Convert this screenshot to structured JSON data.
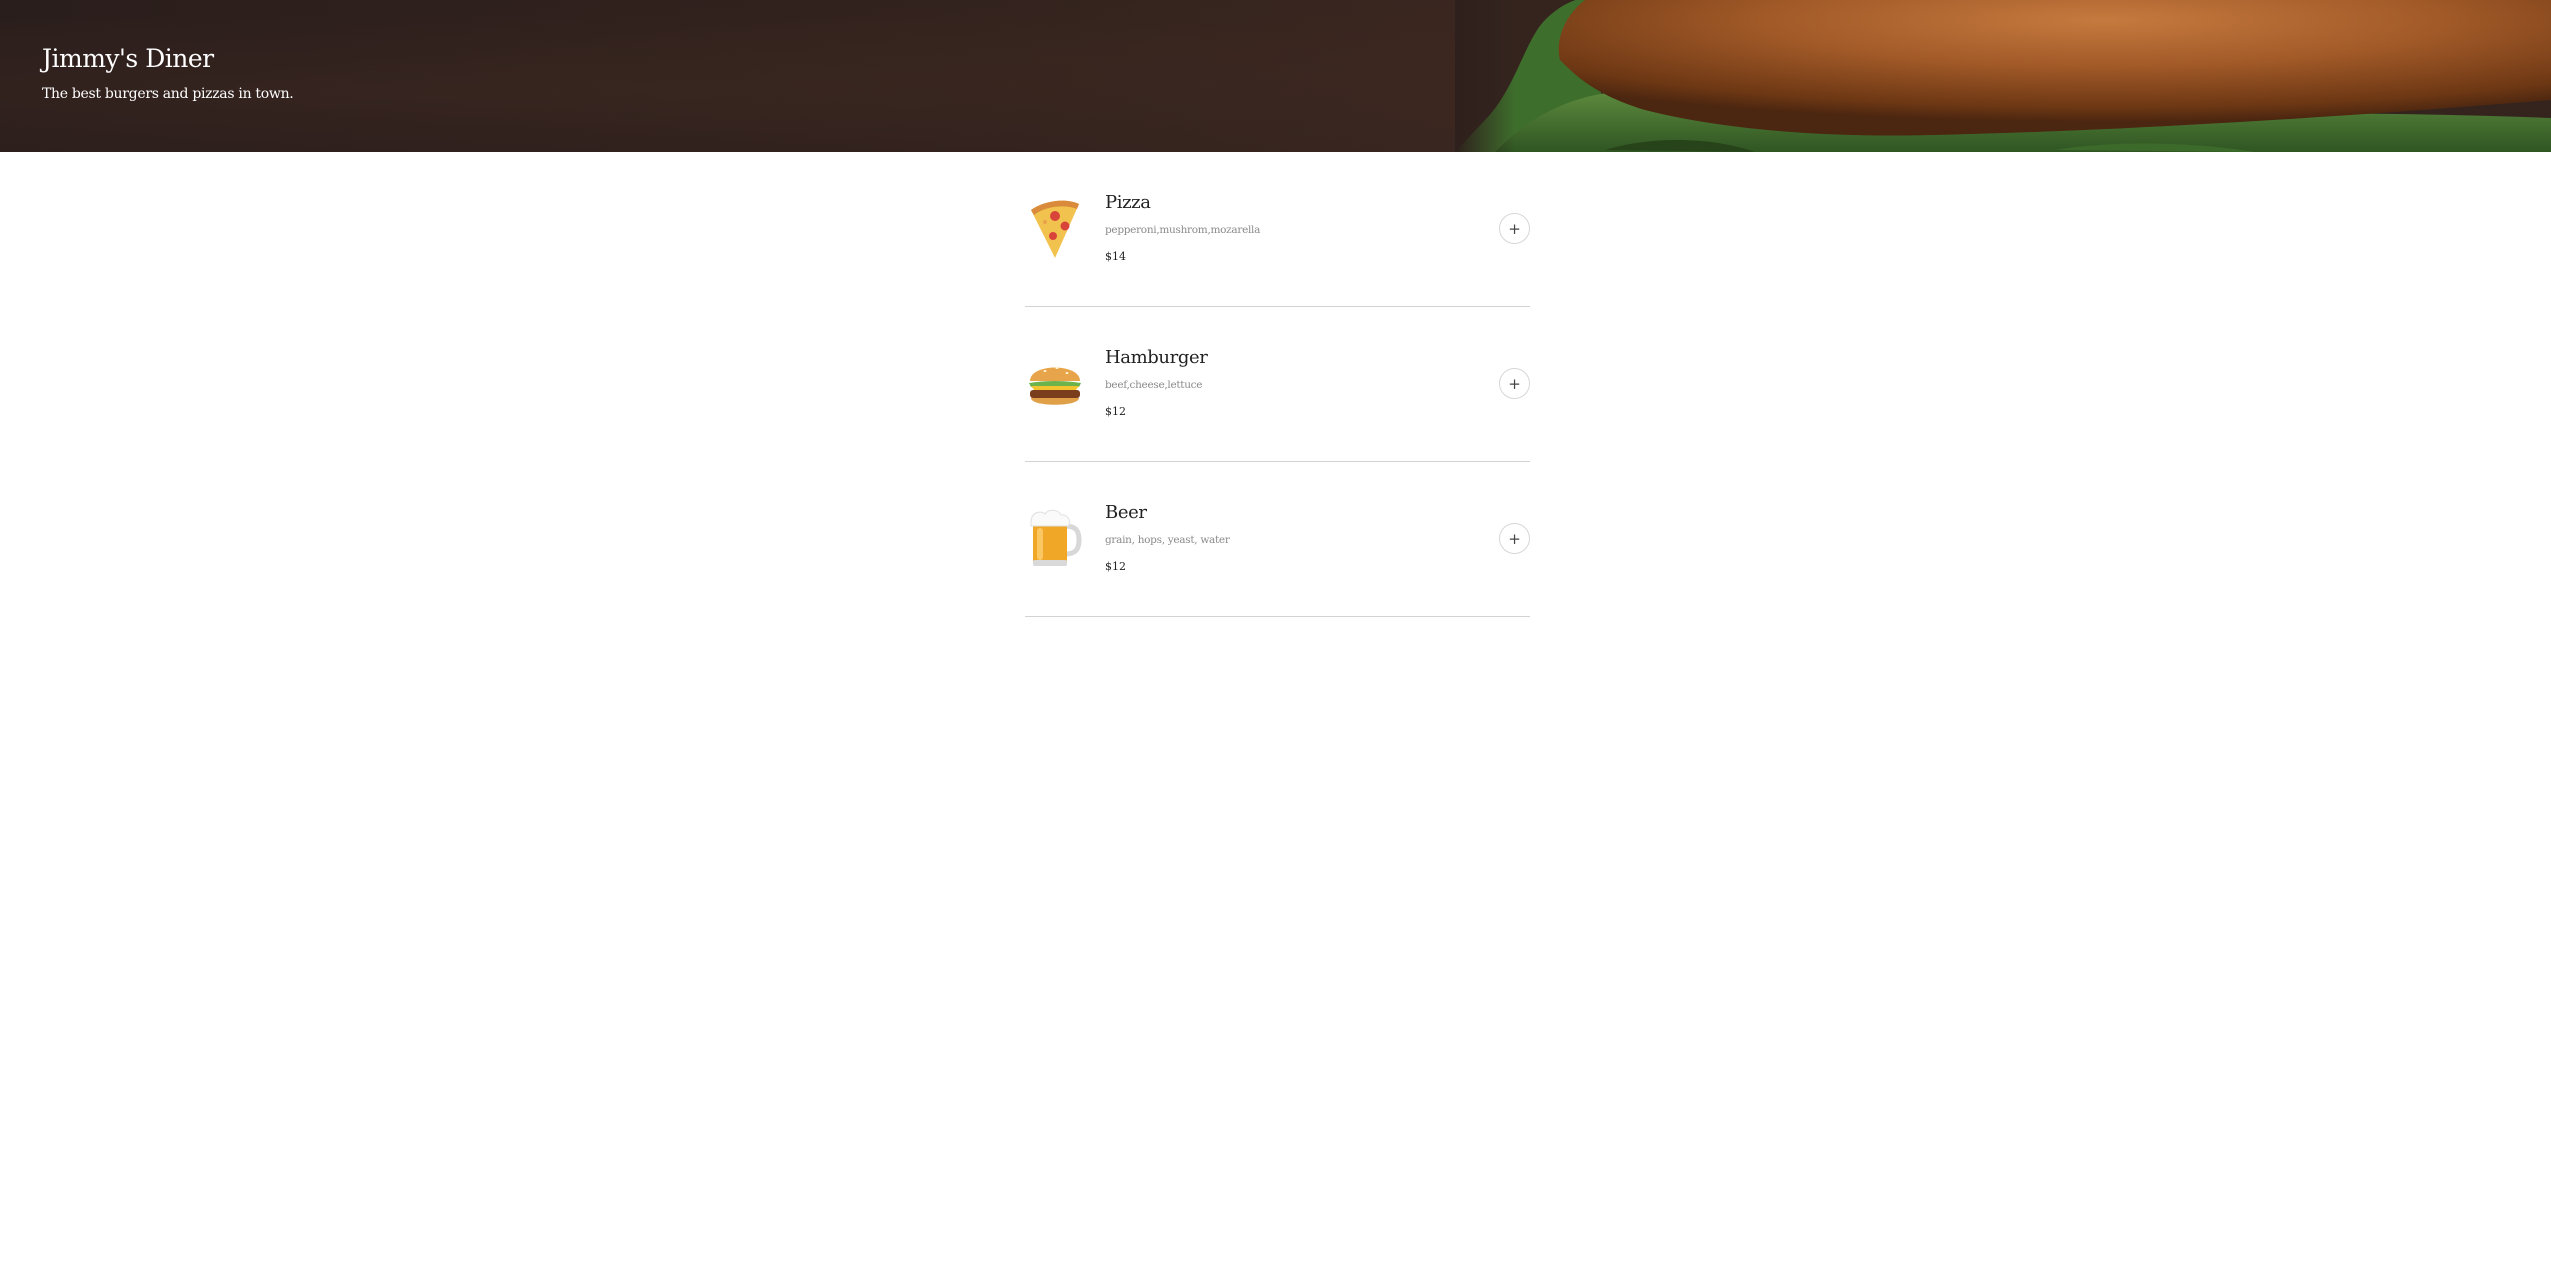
{
  "header": {
    "title": "Jimmy's Diner",
    "subtitle": "The best burgers and pizzas in town."
  },
  "menu": {
    "items": [
      {
        "name": "Pizza",
        "ingredients": "pepperoni,mushrom,mozarella",
        "price": "$14",
        "icon": "pizza-icon",
        "add_label": "+"
      },
      {
        "name": "Hamburger",
        "ingredients": "beef,cheese,lettuce",
        "price": "$12",
        "icon": "hamburger-icon",
        "add_label": "+"
      },
      {
        "name": "Beer",
        "ingredients": "grain, hops, yeast, water",
        "price": "$12",
        "icon": "beer-icon",
        "add_label": "+"
      }
    ]
  },
  "colors": {
    "hero_background": "#2e201c",
    "divider": "#d3d3d3",
    "muted_text": "#8b8b8b"
  }
}
